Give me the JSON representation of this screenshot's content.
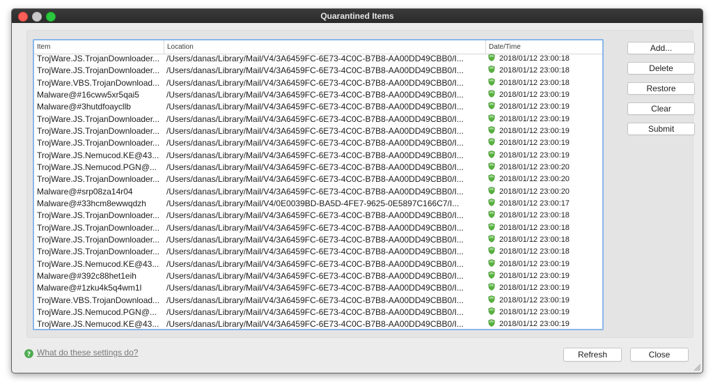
{
  "window": {
    "title": "Quarantined Items"
  },
  "table": {
    "columns": [
      "Item",
      "Location",
      "Date/Time"
    ],
    "rows": [
      {
        "item": "TrojWare.JS.TrojanDownloader...",
        "location": "/Users/danas/Library/Mail/V4/3A6459FC-6E73-4C0C-B7B8-AA00DD49CBB0/I...",
        "datetime": "2018/01/12 23:00:18"
      },
      {
        "item": "TrojWare.JS.TrojanDownloader...",
        "location": "/Users/danas/Library/Mail/V4/3A6459FC-6E73-4C0C-B7B8-AA00DD49CBB0/I...",
        "datetime": "2018/01/12 23:00:18"
      },
      {
        "item": "TrojWare.VBS.TrojanDownload...",
        "location": "/Users/danas/Library/Mail/V4/3A6459FC-6E73-4C0C-B7B8-AA00DD49CBB0/I...",
        "datetime": "2018/01/12 23:00:18"
      },
      {
        "item": "Malware@#16cww5xr5qai5",
        "location": "/Users/danas/Library/Mail/V4/3A6459FC-6E73-4C0C-B7B8-AA00DD49CBB0/I...",
        "datetime": "2018/01/12 23:00:19"
      },
      {
        "item": "Malware@#3hutdfoaycllb",
        "location": "/Users/danas/Library/Mail/V4/3A6459FC-6E73-4C0C-B7B8-AA00DD49CBB0/I...",
        "datetime": "2018/01/12 23:00:19"
      },
      {
        "item": "TrojWare.JS.TrojanDownloader...",
        "location": "/Users/danas/Library/Mail/V4/3A6459FC-6E73-4C0C-B7B8-AA00DD49CBB0/I...",
        "datetime": "2018/01/12 23:00:19"
      },
      {
        "item": "TrojWare.JS.TrojanDownloader...",
        "location": "/Users/danas/Library/Mail/V4/3A6459FC-6E73-4C0C-B7B8-AA00DD49CBB0/I...",
        "datetime": "2018/01/12 23:00:19"
      },
      {
        "item": "TrojWare.JS.TrojanDownloader...",
        "location": "/Users/danas/Library/Mail/V4/3A6459FC-6E73-4C0C-B7B8-AA00DD49CBB0/I...",
        "datetime": "2018/01/12 23:00:19"
      },
      {
        "item": "TrojWare.JS.Nemucod.KE@43...",
        "location": "/Users/danas/Library/Mail/V4/3A6459FC-6E73-4C0C-B7B8-AA00DD49CBB0/I...",
        "datetime": "2018/01/12 23:00:19"
      },
      {
        "item": "TrojWare.JS.Nemucod.PGN@...",
        "location": "/Users/danas/Library/Mail/V4/3A6459FC-6E73-4C0C-B7B8-AA00DD49CBB0/I...",
        "datetime": "2018/01/12 23:00:20"
      },
      {
        "item": "TrojWare.JS.TrojanDownloader...",
        "location": "/Users/danas/Library/Mail/V4/3A6459FC-6E73-4C0C-B7B8-AA00DD49CBB0/I...",
        "datetime": "2018/01/12 23:00:20"
      },
      {
        "item": "Malware@#srp08za14r04",
        "location": "/Users/danas/Library/Mail/V4/3A6459FC-6E73-4C0C-B7B8-AA00DD49CBB0/I...",
        "datetime": "2018/01/12 23:00:20"
      },
      {
        "item": "Malware@#33hcm8ewwqdzh",
        "location": "/Users/danas/Library/Mail/V4/0E0039BD-BA5D-4FE7-9625-0E5897C166C7/I...",
        "datetime": "2018/01/12 23:00:17"
      },
      {
        "item": "TrojWare.JS.TrojanDownloader...",
        "location": "/Users/danas/Library/Mail/V4/3A6459FC-6E73-4C0C-B7B8-AA00DD49CBB0/I...",
        "datetime": "2018/01/12 23:00:18"
      },
      {
        "item": "TrojWare.JS.TrojanDownloader...",
        "location": "/Users/danas/Library/Mail/V4/3A6459FC-6E73-4C0C-B7B8-AA00DD49CBB0/I...",
        "datetime": "2018/01/12 23:00:18"
      },
      {
        "item": "TrojWare.JS.TrojanDownloader...",
        "location": "/Users/danas/Library/Mail/V4/3A6459FC-6E73-4C0C-B7B8-AA00DD49CBB0/I...",
        "datetime": "2018/01/12 23:00:18"
      },
      {
        "item": "TrojWare.JS.TrojanDownloader...",
        "location": "/Users/danas/Library/Mail/V4/3A6459FC-6E73-4C0C-B7B8-AA00DD49CBB0/I...",
        "datetime": "2018/01/12 23:00:18"
      },
      {
        "item": "TrojWare.JS.Nemucod.KE@43...",
        "location": "/Users/danas/Library/Mail/V4/3A6459FC-6E73-4C0C-B7B8-AA00DD49CBB0/I...",
        "datetime": "2018/01/12 23:00:19"
      },
      {
        "item": "Malware@#392c88het1eih",
        "location": "/Users/danas/Library/Mail/V4/3A6459FC-6E73-4C0C-B7B8-AA00DD49CBB0/I...",
        "datetime": "2018/01/12 23:00:19"
      },
      {
        "item": "Malware@#1zku4k5q4wm1l",
        "location": "/Users/danas/Library/Mail/V4/3A6459FC-6E73-4C0C-B7B8-AA00DD49CBB0/I...",
        "datetime": "2018/01/12 23:00:19"
      },
      {
        "item": "TrojWare.VBS.TrojanDownload...",
        "location": "/Users/danas/Library/Mail/V4/3A6459FC-6E73-4C0C-B7B8-AA00DD49CBB0/I...",
        "datetime": "2018/01/12 23:00:19"
      },
      {
        "item": "TrojWare.JS.Nemucod.PGN@...",
        "location": "/Users/danas/Library/Mail/V4/3A6459FC-6E73-4C0C-B7B8-AA00DD49CBB0/I...",
        "datetime": "2018/01/12 23:00:19"
      },
      {
        "item": "TrojWare.JS.Nemucod.KE@43...",
        "location": "/Users/danas/Library/Mail/V4/3A6459FC-6E73-4C0C-B7B8-AA00DD49CBB0/I...",
        "datetime": "2018/01/12 23:00:19"
      }
    ],
    "row_icon": "green-shield-icon"
  },
  "actions": {
    "add": "Add...",
    "delete": "Delete",
    "restore": "Restore",
    "clear": "Clear",
    "submit": "Submit"
  },
  "footer": {
    "help_link": "What do these settings do?",
    "help_icon": "question-mark-icon",
    "refresh": "Refresh",
    "close": "Close"
  },
  "colors": {
    "accent_focus": "#8ab6e8",
    "titlebar": "#2e2e2e",
    "shield_green": "#57b33e"
  }
}
